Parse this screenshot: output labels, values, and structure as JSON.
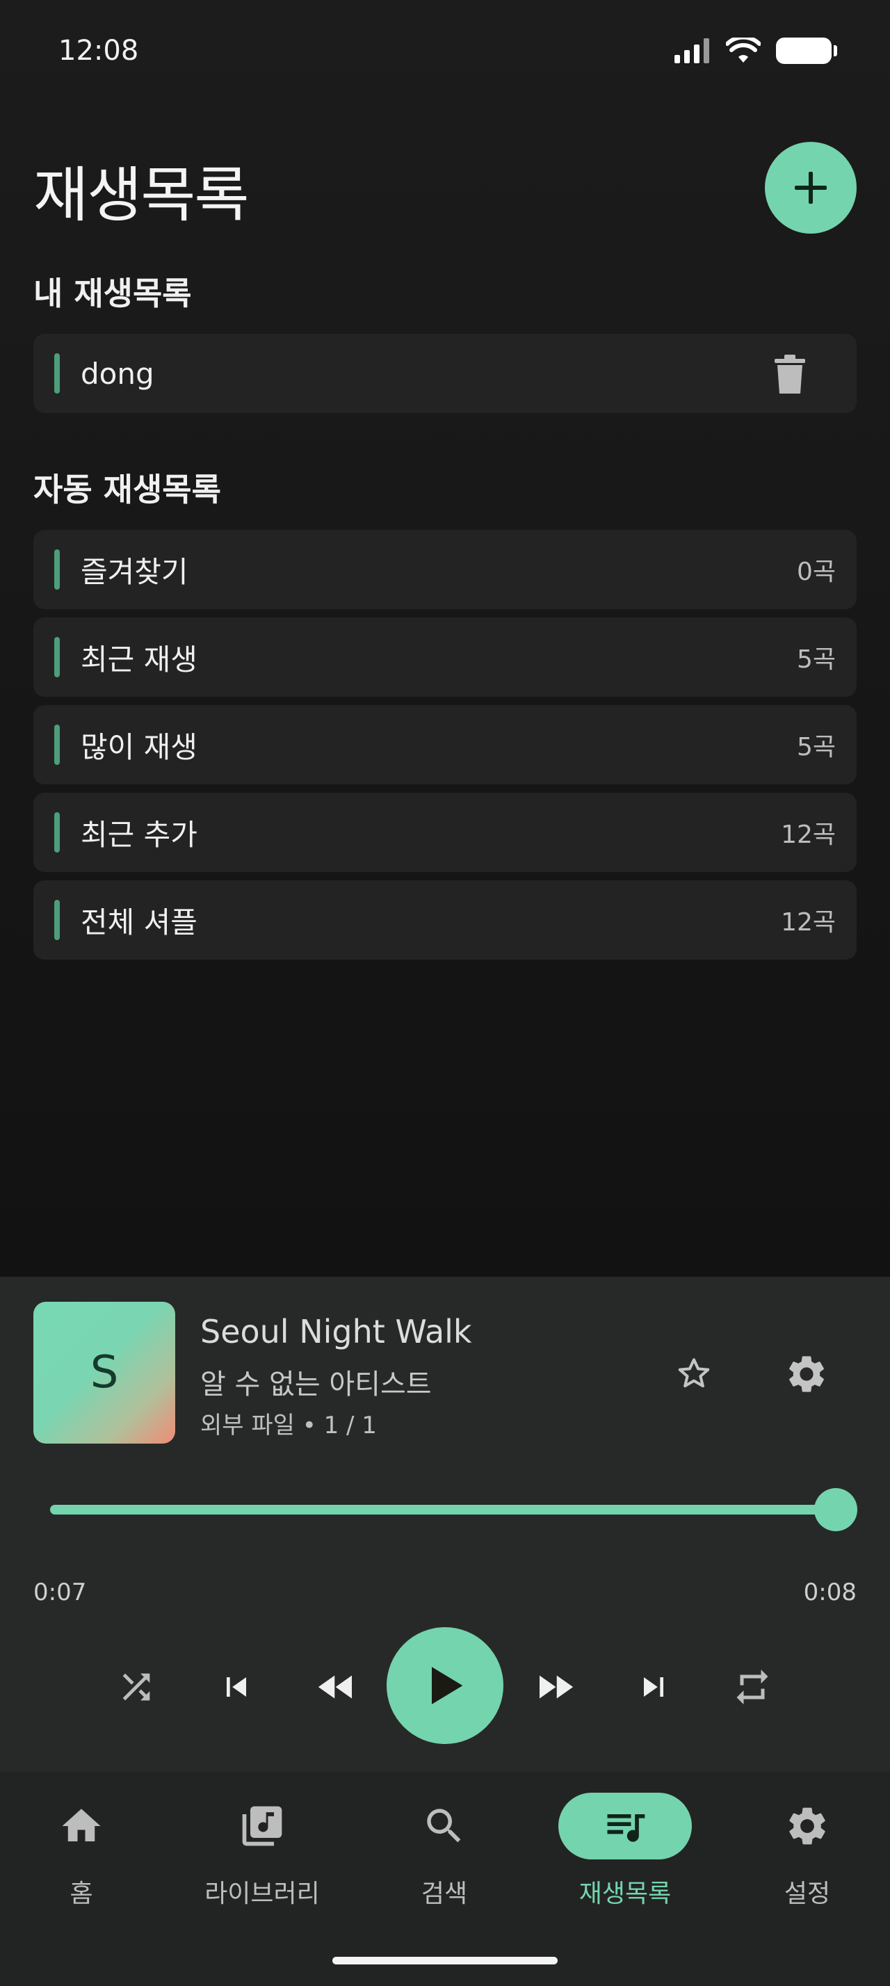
{
  "status_bar": {
    "time": "12:08"
  },
  "header": {
    "title": "재생목록"
  },
  "my_playlists": {
    "title": "내 재생목록",
    "items": [
      {
        "name": "dong"
      }
    ]
  },
  "auto_playlists": {
    "title": "자동 재생목록",
    "items": [
      {
        "name": "즐겨찾기",
        "count": "0곡"
      },
      {
        "name": "최근 재생",
        "count": "5곡"
      },
      {
        "name": "많이 재생",
        "count": "5곡"
      },
      {
        "name": "최근 추가",
        "count": "12곡"
      },
      {
        "name": "전체 셔플",
        "count": "12곡"
      }
    ]
  },
  "player": {
    "art_letter": "S",
    "title": "Seoul Night Walk",
    "artist": "알 수 없는 아티스트",
    "meta": "외부 파일 • 1 / 1",
    "elapsed": "0:07",
    "duration": "0:08",
    "progress": 1.0
  },
  "nav": {
    "items": [
      {
        "label": "홈",
        "icon": "home-icon"
      },
      {
        "label": "라이브러리",
        "icon": "library-music-icon"
      },
      {
        "label": "검색",
        "icon": "search-icon"
      },
      {
        "label": "재생목록",
        "icon": "queue-music-icon",
        "active": true
      },
      {
        "label": "설정",
        "icon": "gear-icon"
      }
    ]
  },
  "colors": {
    "accent": "#74d4ae",
    "row_accent": "#4e9e7c",
    "background": "#121212",
    "player_background": "#272928"
  }
}
